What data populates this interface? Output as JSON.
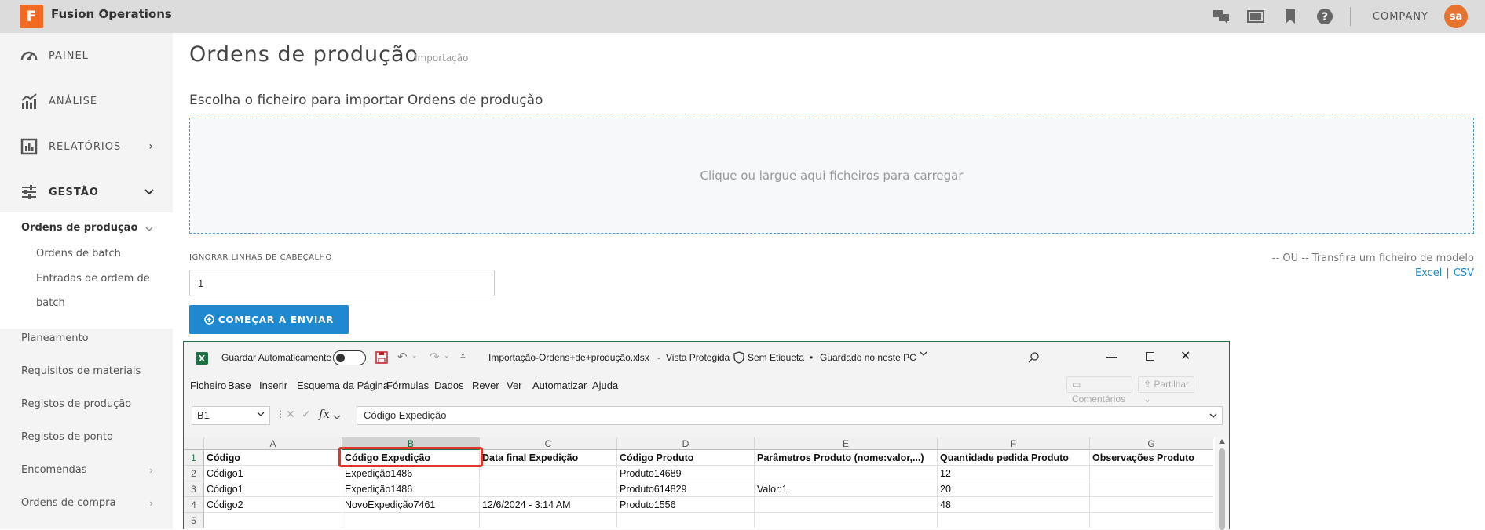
{
  "app": {
    "logo_letter": "F",
    "name": "Fusion Operations",
    "company": "COMPANY",
    "avatar_initials": "sa"
  },
  "sidebar": {
    "main_items": [
      {
        "label": "PAINEL",
        "icon": "gauge-icon"
      },
      {
        "label": "ANÁLISE",
        "icon": "chart-icon"
      },
      {
        "label": "RELATÓRIOS",
        "icon": "report-icon",
        "chevron": "›"
      },
      {
        "label": "GESTÃO",
        "icon": "sliders-icon",
        "chevron": "⌄"
      }
    ],
    "active_group": "Ordens de produção",
    "active_children": [
      "Ordens de batch",
      "Entradas de ordem de",
      "batch"
    ],
    "items": [
      "Planeamento",
      "Requisitos de materiais",
      "Registos de produção",
      "Registos de ponto",
      "Encomendas",
      "Ordens de compra"
    ]
  },
  "main": {
    "title": "Ordens de produção",
    "subtitle": "Importação",
    "choose_label": "Escolha o ficheiro para importar Ordens de produção",
    "dropzone_text": "Clique ou largue aqui ficheiros para carregar",
    "ignore_label": "IGNORAR LINHAS DE CABEÇALHO",
    "ignore_value": "1",
    "template_text": "-- OU -- Transfira um ficheiro de modelo",
    "link_excel": "Excel",
    "link_sep": "|",
    "link_csv": "CSV",
    "start_button": "COMEÇAR A ENVIAR"
  },
  "excel": {
    "autosave_label": "Guardar Automaticamente",
    "filename": "Importação-Ordens+de+produção.xlsx",
    "dash": "-",
    "protected": "Vista Protegida",
    "label_status": "Sem Etiqueta",
    "dot": "•",
    "saved": "Guardado no neste PC",
    "menu": [
      "Ficheiro",
      "Base",
      "Inserir",
      "Esquema da Página",
      "Fórmulas",
      "Dados",
      "Rever",
      "Ver",
      "Automatizar",
      "Ajuda"
    ],
    "comments_btn": "Comentários",
    "share_btn": "Partilhar",
    "namebox": "B1",
    "fx": "fx",
    "formula": "Código Expedição",
    "columns": [
      "A",
      "B",
      "C",
      "D",
      "E",
      "F",
      "G"
    ],
    "rows": [
      "1",
      "2",
      "3",
      "4",
      "5"
    ],
    "cells": [
      [
        "Código",
        "Código Expedição",
        "Data final Expedição",
        "Código Produto",
        "Parâmetros Produto (nome:valor,...)",
        "Quantidade pedida Produto",
        "Observações Produto"
      ],
      [
        "Código1",
        "Expedição1486",
        "",
        "Produto14689",
        "",
        "12",
        ""
      ],
      [
        "Código1",
        "Expedição1486",
        "",
        "Produto614829",
        "Valor:1",
        "20",
        ""
      ],
      [
        "Código2",
        "NovoExpedição7461",
        "12/6/2024 - 3:14 AM",
        "Produto1556",
        "",
        "48",
        ""
      ],
      [
        "",
        "",
        "",
        "",
        "",
        "",
        ""
      ]
    ]
  }
}
